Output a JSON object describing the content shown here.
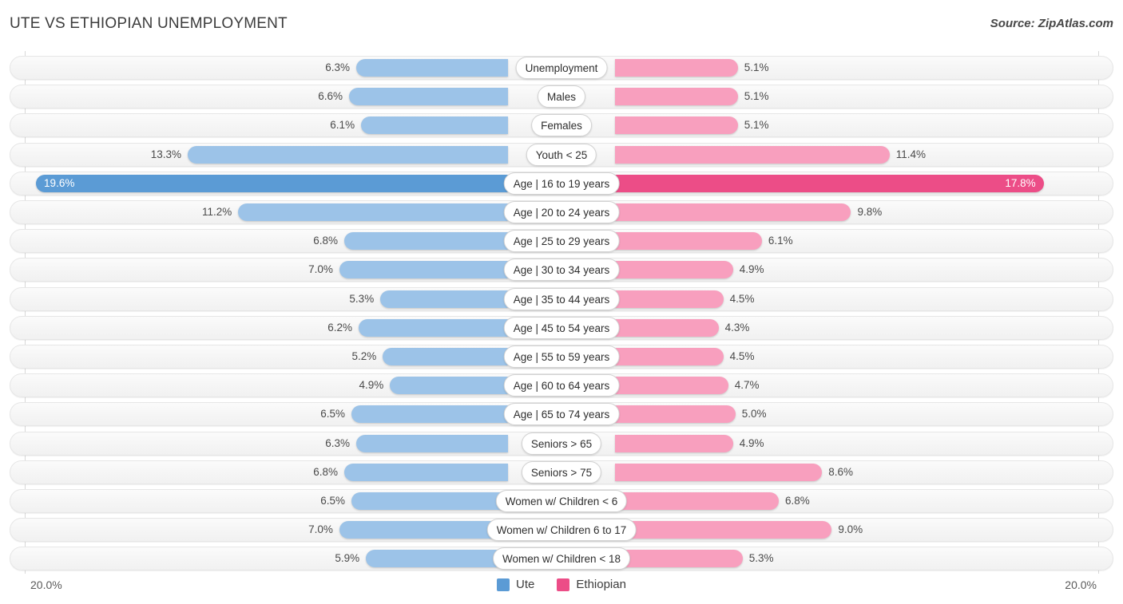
{
  "header": {
    "title": "UTE VS ETHIOPIAN UNEMPLOYMENT",
    "source": "Source: ZipAtlas.com"
  },
  "footer": {
    "axis_left_label": "20.0%",
    "axis_right_label": "20.0%"
  },
  "legend": {
    "items": [
      {
        "label": "Ute",
        "color": "#5b9bd5"
      },
      {
        "label": "Ethiopian",
        "color": "#ec4d87"
      }
    ]
  },
  "colors": {
    "left_normal": "#9cc3e8",
    "left_highlight": "#5b9bd5",
    "right_normal": "#f89fbe",
    "right_highlight": "#ec4d87",
    "track": "#f5f5f5",
    "axis": "#d8d8d8"
  },
  "chart_data": {
    "type": "bar",
    "subtype": "diverging-bidirectional",
    "title": "UTE VS ETHIOPIAN UNEMPLOYMENT",
    "source": "Source: ZipAtlas.com",
    "xlabel": "",
    "ylabel": "",
    "axis_max": 20.0,
    "axis_unit": "%",
    "xlim": [
      20.0,
      20.0
    ],
    "grid": false,
    "legend_position": "bottom-center",
    "categories": [
      "Unemployment",
      "Males",
      "Females",
      "Youth < 25",
      "Age | 16 to 19 years",
      "Age | 20 to 24 years",
      "Age | 25 to 29 years",
      "Age | 30 to 34 years",
      "Age | 35 to 44 years",
      "Age | 45 to 54 years",
      "Age | 55 to 59 years",
      "Age | 60 to 64 years",
      "Age | 65 to 74 years",
      "Seniors > 65",
      "Seniors > 75",
      "Women w/ Children < 6",
      "Women w/ Children 6 to 17",
      "Women w/ Children < 18"
    ],
    "series": [
      {
        "name": "Ute",
        "side": "left",
        "color": "#9cc3e8",
        "highlight_color": "#5b9bd5",
        "values": [
          6.3,
          6.6,
          6.1,
          13.3,
          19.6,
          11.2,
          6.8,
          7.0,
          5.3,
          6.2,
          5.2,
          4.9,
          6.5,
          6.3,
          6.8,
          6.5,
          7.0,
          5.9
        ],
        "labels": [
          "6.3%",
          "6.6%",
          "6.1%",
          "13.3%",
          "19.6%",
          "11.2%",
          "6.8%",
          "7.0%",
          "5.3%",
          "6.2%",
          "5.2%",
          "4.9%",
          "6.5%",
          "6.3%",
          "6.8%",
          "6.5%",
          "7.0%",
          "5.9%"
        ]
      },
      {
        "name": "Ethiopian",
        "side": "right",
        "color": "#f89fbe",
        "highlight_color": "#ec4d87",
        "values": [
          5.1,
          5.1,
          5.1,
          11.4,
          17.8,
          9.8,
          6.1,
          4.9,
          4.5,
          4.3,
          4.5,
          4.7,
          5.0,
          4.9,
          8.6,
          6.8,
          9.0,
          5.3
        ],
        "labels": [
          "5.1%",
          "5.1%",
          "5.1%",
          "11.4%",
          "17.8%",
          "9.8%",
          "6.1%",
          "4.9%",
          "4.5%",
          "4.3%",
          "4.5%",
          "4.7%",
          "5.0%",
          "4.9%",
          "8.6%",
          "6.8%",
          "9.0%",
          "5.3%"
        ]
      }
    ],
    "highlighted_row": "Age | 16 to 19 years",
    "rows": [
      {
        "label": "Unemployment",
        "left": 6.3,
        "left_label": "6.3%",
        "right": 5.1,
        "right_label": "5.1%",
        "highlight": false
      },
      {
        "label": "Males",
        "left": 6.6,
        "left_label": "6.6%",
        "right": 5.1,
        "right_label": "5.1%",
        "highlight": false
      },
      {
        "label": "Females",
        "left": 6.1,
        "left_label": "6.1%",
        "right": 5.1,
        "right_label": "5.1%",
        "highlight": false
      },
      {
        "label": "Youth < 25",
        "left": 13.3,
        "left_label": "13.3%",
        "right": 11.4,
        "right_label": "11.4%",
        "highlight": false
      },
      {
        "label": "Age | 16 to 19 years",
        "left": 19.6,
        "left_label": "19.6%",
        "right": 17.8,
        "right_label": "17.8%",
        "highlight": true
      },
      {
        "label": "Age | 20 to 24 years",
        "left": 11.2,
        "left_label": "11.2%",
        "right": 9.8,
        "right_label": "9.8%",
        "highlight": false
      },
      {
        "label": "Age | 25 to 29 years",
        "left": 6.8,
        "left_label": "6.8%",
        "right": 6.1,
        "right_label": "6.1%",
        "highlight": false
      },
      {
        "label": "Age | 30 to 34 years",
        "left": 7.0,
        "left_label": "7.0%",
        "right": 4.9,
        "right_label": "4.9%",
        "highlight": false
      },
      {
        "label": "Age | 35 to 44 years",
        "left": 5.3,
        "left_label": "5.3%",
        "right": 4.5,
        "right_label": "4.5%",
        "highlight": false
      },
      {
        "label": "Age | 45 to 54 years",
        "left": 6.2,
        "left_label": "6.2%",
        "right": 4.3,
        "right_label": "4.3%",
        "highlight": false
      },
      {
        "label": "Age | 55 to 59 years",
        "left": 5.2,
        "left_label": "5.2%",
        "right": 4.5,
        "right_label": "4.5%",
        "highlight": false
      },
      {
        "label": "Age | 60 to 64 years",
        "left": 4.9,
        "left_label": "4.9%",
        "right": 4.7,
        "right_label": "4.7%",
        "highlight": false
      },
      {
        "label": "Age | 65 to 74 years",
        "left": 6.5,
        "left_label": "6.5%",
        "right": 5.0,
        "right_label": "5.0%",
        "highlight": false
      },
      {
        "label": "Seniors > 65",
        "left": 6.3,
        "left_label": "6.3%",
        "right": 4.9,
        "right_label": "4.9%",
        "highlight": false
      },
      {
        "label": "Seniors > 75",
        "left": 6.8,
        "left_label": "6.8%",
        "right": 8.6,
        "right_label": "8.6%",
        "highlight": false
      },
      {
        "label": "Women w/ Children < 6",
        "left": 6.5,
        "left_label": "6.5%",
        "right": 6.8,
        "right_label": "6.8%",
        "highlight": false
      },
      {
        "label": "Women w/ Children 6 to 17",
        "left": 7.0,
        "left_label": "7.0%",
        "right": 9.0,
        "right_label": "9.0%",
        "highlight": false
      },
      {
        "label": "Women w/ Children < 18",
        "left": 5.9,
        "left_label": "5.9%",
        "right": 5.3,
        "right_label": "5.3%",
        "highlight": false
      }
    ]
  }
}
